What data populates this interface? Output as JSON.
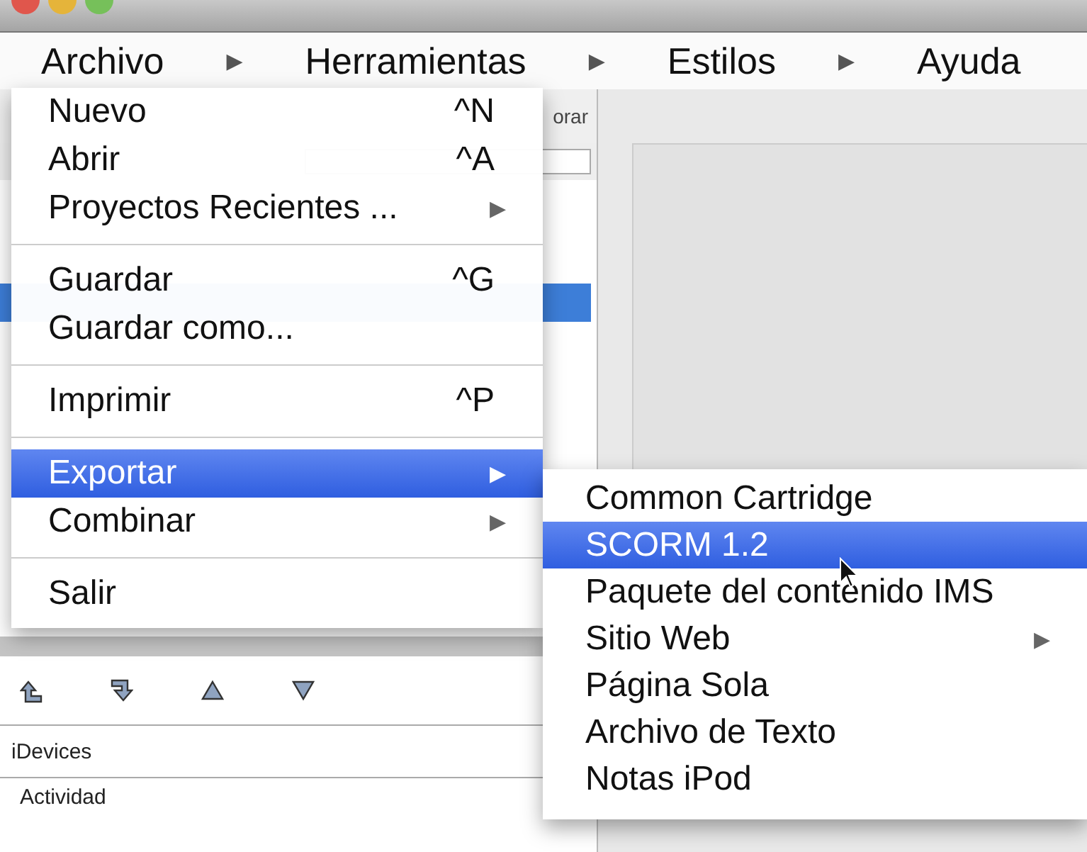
{
  "menubar": [
    {
      "label": "Archivo",
      "arrow": "▶"
    },
    {
      "label": "Herramientas",
      "arrow": "▶"
    },
    {
      "label": "Estilos",
      "arrow": "▶"
    },
    {
      "label": "Ayuda"
    }
  ],
  "toolbar": {
    "partial_label": "orar"
  },
  "idevices": {
    "header": "iDevices",
    "items": [
      "Actividad"
    ]
  },
  "menu": [
    {
      "kind": "item",
      "label": "Nuevo",
      "shortcut": "^N",
      "selected": false
    },
    {
      "kind": "item",
      "label": "Abrir",
      "shortcut": "^A",
      "selected": false
    },
    {
      "kind": "item",
      "label": "Proyectos Recientes ...",
      "arrow": "▶",
      "selected": false
    },
    {
      "kind": "separator"
    },
    {
      "kind": "item",
      "label": "Guardar",
      "shortcut": "^G",
      "selected": false
    },
    {
      "kind": "item",
      "label": "Guardar como...",
      "selected": false
    },
    {
      "kind": "separator"
    },
    {
      "kind": "item",
      "label": "Imprimir",
      "shortcut": "^P",
      "selected": false
    },
    {
      "kind": "separator"
    },
    {
      "kind": "item",
      "label": "Exportar",
      "arrow": "▶",
      "selected": true
    },
    {
      "kind": "item",
      "label": "Combinar",
      "arrow": "▶",
      "selected": false
    },
    {
      "kind": "separator"
    },
    {
      "kind": "item",
      "label": "Salir",
      "selected": false
    }
  ],
  "submenu": [
    {
      "label": "Common Cartridge",
      "selected": false
    },
    {
      "label": "SCORM 1.2",
      "selected": true
    },
    {
      "label": "Paquete del contenido IMS",
      "selected": false
    },
    {
      "label": "Sitio Web",
      "arrow": "▶",
      "selected": false
    },
    {
      "label": "Página Sola",
      "selected": false
    },
    {
      "label": "Archivo de Texto",
      "selected": false
    },
    {
      "label": "Notas iPod",
      "selected": false
    }
  ]
}
